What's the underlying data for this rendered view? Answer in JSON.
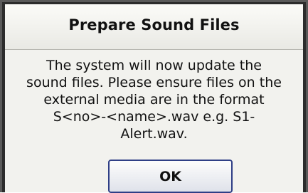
{
  "dialog": {
    "title": "Prepare Sound Files",
    "message_lines": [
      "The system will now update the",
      "sound files. Please ensure files on the",
      "external media are in the format",
      "S<no>-<name>.wav e.g. S1-",
      "Alert.wav."
    ],
    "ok_label": "OK"
  }
}
